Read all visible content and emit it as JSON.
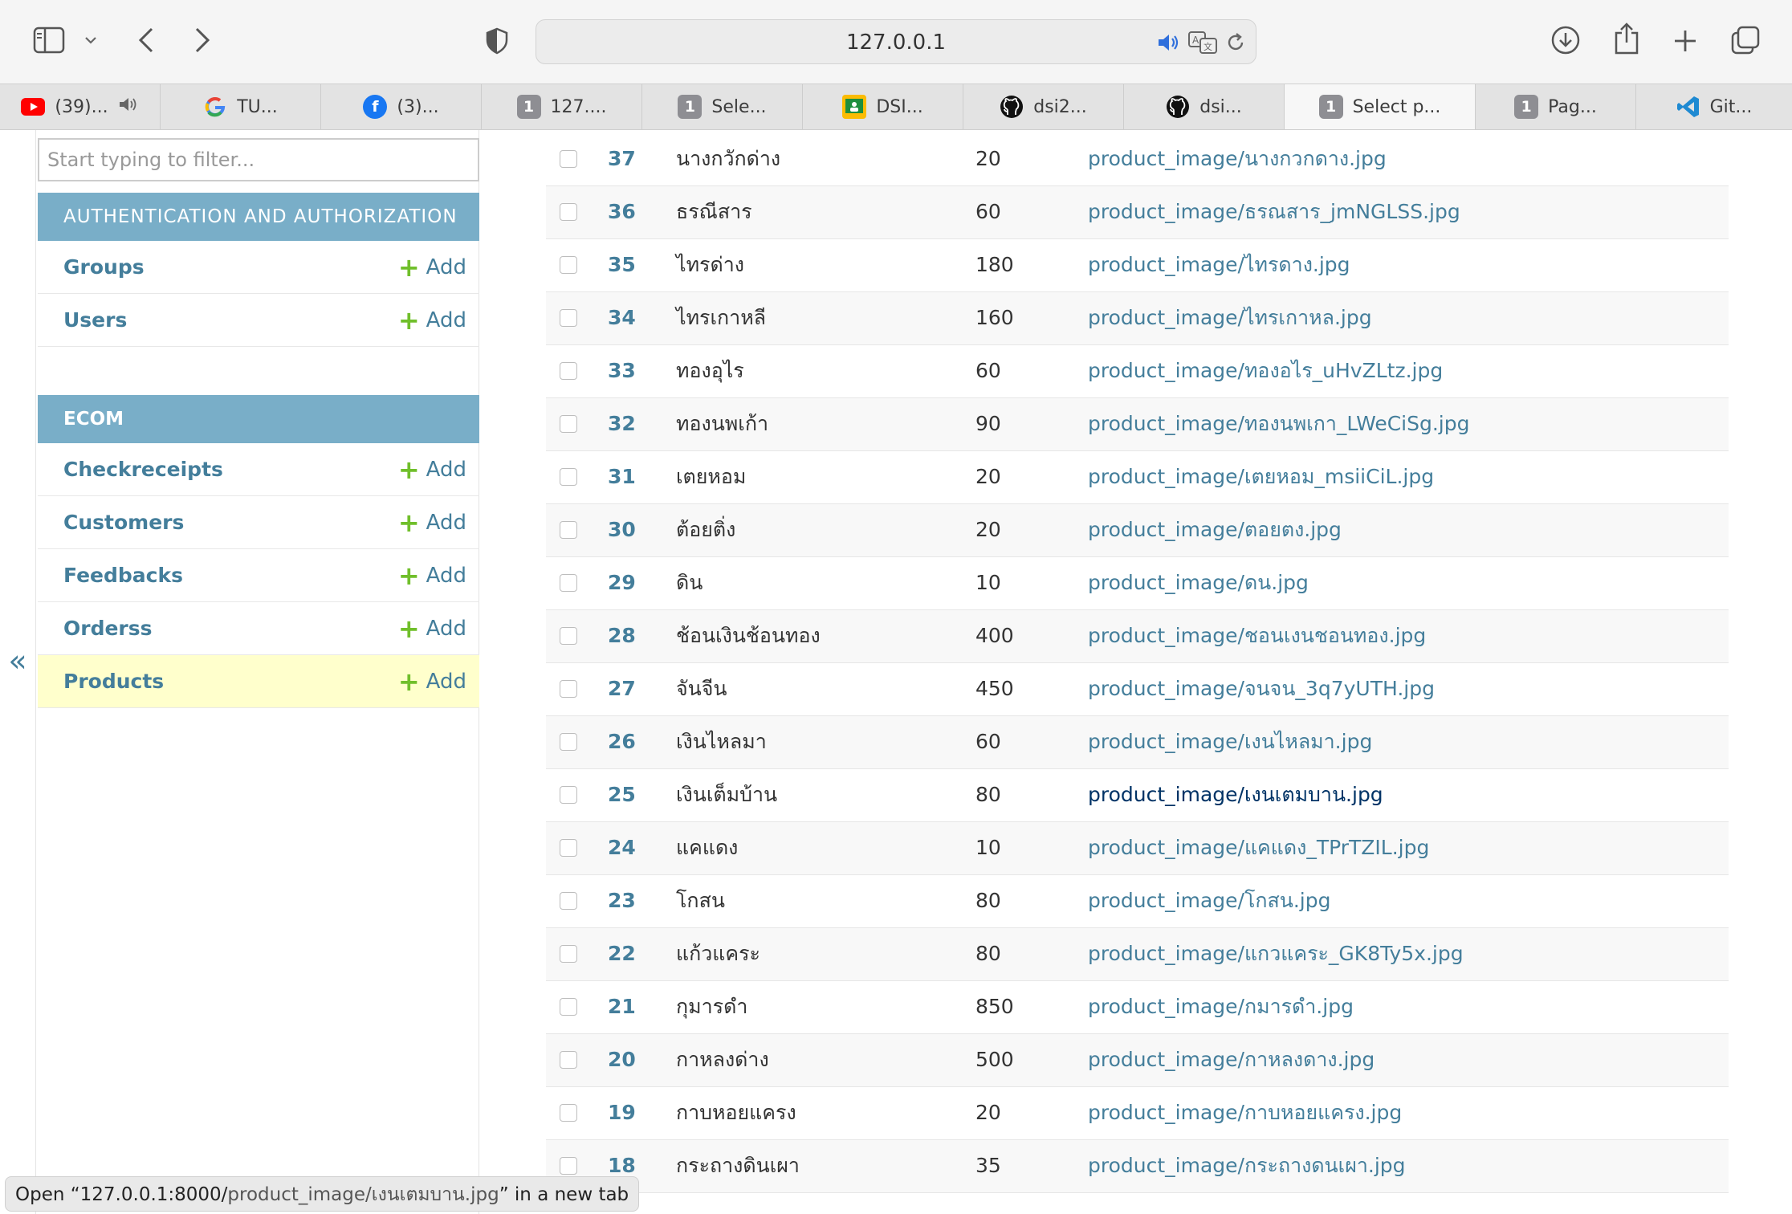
{
  "browser": {
    "url": "127.0.0.1",
    "icons": [
      "sidebar-icon",
      "chevron-down-icon",
      "back-icon",
      "forward-icon",
      "shield-icon",
      "speaker-icon",
      "translate-icon",
      "reload-icon",
      "download-icon",
      "share-icon",
      "plus-icon",
      "tabs-overview-icon"
    ],
    "tabs": [
      {
        "label": "(39)...",
        "icon": "youtube-icon"
      },
      {
        "label": "TU...",
        "icon": "google-icon"
      },
      {
        "label": "(3)...",
        "icon": "facebook-icon"
      },
      {
        "label": "127....",
        "icon": "1"
      },
      {
        "label": "Sele...",
        "icon": "1"
      },
      {
        "label": "DSI...",
        "icon": "classroom-icon"
      },
      {
        "label": "dsi2...",
        "icon": "github-icon"
      },
      {
        "label": "dsi...",
        "icon": "github-icon"
      },
      {
        "label": "Select p...",
        "icon": "1",
        "active": true
      },
      {
        "label": "Pag...",
        "icon": "1"
      },
      {
        "label": "Git...",
        "icon": "vscode-icon"
      }
    ]
  },
  "sidebar": {
    "collapse_label": "«",
    "filter_placeholder": "Start typing to filter...",
    "modules": [
      {
        "caption": "AUTHENTICATION AND AUTHORIZATION",
        "models": [
          {
            "name": "Groups",
            "add_label": "Add"
          },
          {
            "name": "Users",
            "add_label": "Add"
          }
        ]
      },
      {
        "caption": "ECOM",
        "models": [
          {
            "name": "Checkreceipts",
            "add_label": "Add"
          },
          {
            "name": "Customers",
            "add_label": "Add"
          },
          {
            "name": "Feedbacks",
            "add_label": "Add"
          },
          {
            "name": "Orderss",
            "add_label": "Add"
          },
          {
            "name": "Products",
            "add_label": "Add",
            "current": true
          }
        ]
      }
    ]
  },
  "results": {
    "rows": [
      {
        "id": "37",
        "name": "นางกวักด่าง",
        "price": "20",
        "image": "product_image/นางกวกดาง.jpg"
      },
      {
        "id": "36",
        "name": "ธรณีสาร",
        "price": "60",
        "image": "product_image/ธรณสาร_jmNGLSS.jpg"
      },
      {
        "id": "35",
        "name": "ไทรด่าง",
        "price": "180",
        "image": "product_image/ไทรดาง.jpg"
      },
      {
        "id": "34",
        "name": "ไทรเกาหลี",
        "price": "160",
        "image": "product_image/ไทรเกาหล.jpg"
      },
      {
        "id": "33",
        "name": "ทองอุไร",
        "price": "60",
        "image": "product_image/ทองอไร_uHvZLtz.jpg"
      },
      {
        "id": "32",
        "name": "ทองนพเก้า",
        "price": "90",
        "image": "product_image/ทองนพเกา_LWeCiSg.jpg"
      },
      {
        "id": "31",
        "name": "เตยหอม",
        "price": "20",
        "image": "product_image/เตยหอม_msiiCiL.jpg"
      },
      {
        "id": "30",
        "name": "ต้อยติ่ง",
        "price": "20",
        "image": "product_image/ตอยตง.jpg"
      },
      {
        "id": "29",
        "name": "ดิน",
        "price": "10",
        "image": "product_image/ดน.jpg"
      },
      {
        "id": "28",
        "name": "ช้อนเงินช้อนทอง",
        "price": "400",
        "image": "product_image/ชอนเงนชอนทอง.jpg"
      },
      {
        "id": "27",
        "name": "จันจีน",
        "price": "450",
        "image": "product_image/จนจน_3q7yUTH.jpg"
      },
      {
        "id": "26",
        "name": "เงินไหลมา",
        "price": "60",
        "image": "product_image/เงนไหลมา.jpg"
      },
      {
        "id": "25",
        "name": "เงินเต็มบ้าน",
        "price": "80",
        "image": "product_image/เงนเตมบาน.jpg",
        "hover": true
      },
      {
        "id": "24",
        "name": "แคแดง",
        "price": "10",
        "image": "product_image/แคแดง_TPrTZIL.jpg"
      },
      {
        "id": "23",
        "name": "โกสน",
        "price": "80",
        "image": "product_image/โกสน.jpg"
      },
      {
        "id": "22",
        "name": "แก้วแคระ",
        "price": "80",
        "image": "product_image/แกวแคระ_GK8Ty5x.jpg"
      },
      {
        "id": "21",
        "name": "กุมารดำ",
        "price": "850",
        "image": "product_image/กมารดำ.jpg"
      },
      {
        "id": "20",
        "name": "กาหลงด่าง",
        "price": "500",
        "image": "product_image/กาหลงดาง.jpg"
      },
      {
        "id": "19",
        "name": "กาบหอยแครง",
        "price": "20",
        "image": "product_image/กาบหอยแครง.jpg"
      },
      {
        "id": "18",
        "name": "กระถางดินเผา",
        "price": "35",
        "image": "product_image/กระถางดนเผา.jpg"
      }
    ]
  },
  "status_bar": {
    "prefix": "Open “127.0.0.1:8000/",
    "path": "product_image/เงนเตมบาน.jpg",
    "suffix": "” in a new tab"
  },
  "colors": {
    "link": "#447e9b",
    "module_caption": "#79aec8",
    "add_plus": "#70bf2b",
    "current_row": "#ffffcc"
  }
}
